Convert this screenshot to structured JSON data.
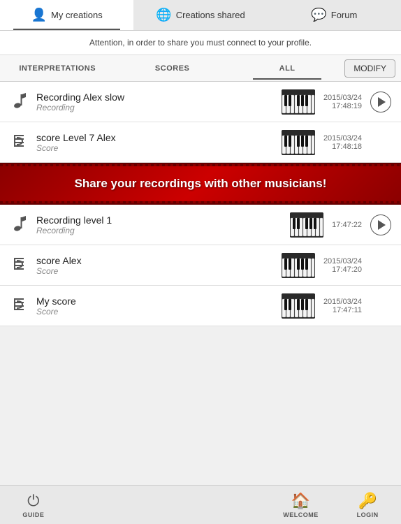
{
  "tabs": [
    {
      "id": "my-creations",
      "label": "My creations",
      "icon": "👤",
      "active": true
    },
    {
      "id": "creations-shared",
      "label": "Creations shared",
      "icon": "🌐",
      "active": false
    },
    {
      "id": "forum",
      "label": "Forum",
      "icon": "💬",
      "active": false
    }
  ],
  "attention": {
    "text": "Attention, in order to share you must connect to your profile."
  },
  "subTabs": [
    {
      "id": "interpretations",
      "label": "INTERPRETATIONS",
      "active": false
    },
    {
      "id": "scores",
      "label": "SCORES",
      "active": false
    },
    {
      "id": "all",
      "label": "ALL",
      "active": true
    }
  ],
  "modifyButton": "MODIFY",
  "items": [
    {
      "id": "item1",
      "icon": "♩",
      "iconType": "note",
      "title": "Recording Alex slow",
      "subtitle": "Recording",
      "date": "2015/03/24",
      "time": "17:48:19",
      "hasPlay": true
    },
    {
      "id": "item2",
      "icon": "𝄢",
      "iconType": "score",
      "title": "score Level 7 Alex",
      "subtitle": "Score",
      "date": "2015/03/24",
      "time": "17:48:18",
      "hasPlay": false
    },
    {
      "id": "item3",
      "icon": "♩",
      "iconType": "note",
      "title": "Recording level 1",
      "subtitle": "Recording",
      "date": "",
      "time": "17:47:22",
      "hasPlay": true
    },
    {
      "id": "item4",
      "icon": "𝄢",
      "iconType": "score",
      "title": "score Alex",
      "subtitle": "Score",
      "date": "2015/03/24",
      "time": "17:47:20",
      "hasPlay": false
    },
    {
      "id": "item5",
      "icon": "𝄢",
      "iconType": "score",
      "title": "My score",
      "subtitle": "Score",
      "date": "2015/03/24",
      "time": "17:47:11",
      "hasPlay": false
    }
  ],
  "promoBanner": {
    "text": "Share your recordings with other musicians!"
  },
  "footer": {
    "items": [
      {
        "id": "guide",
        "label": "GUIDE",
        "icon": "⏻"
      },
      {
        "id": "welcome",
        "label": "WELCOME",
        "icon": "🏠"
      },
      {
        "id": "login",
        "label": "LOGIN",
        "icon": "🔑"
      }
    ]
  }
}
